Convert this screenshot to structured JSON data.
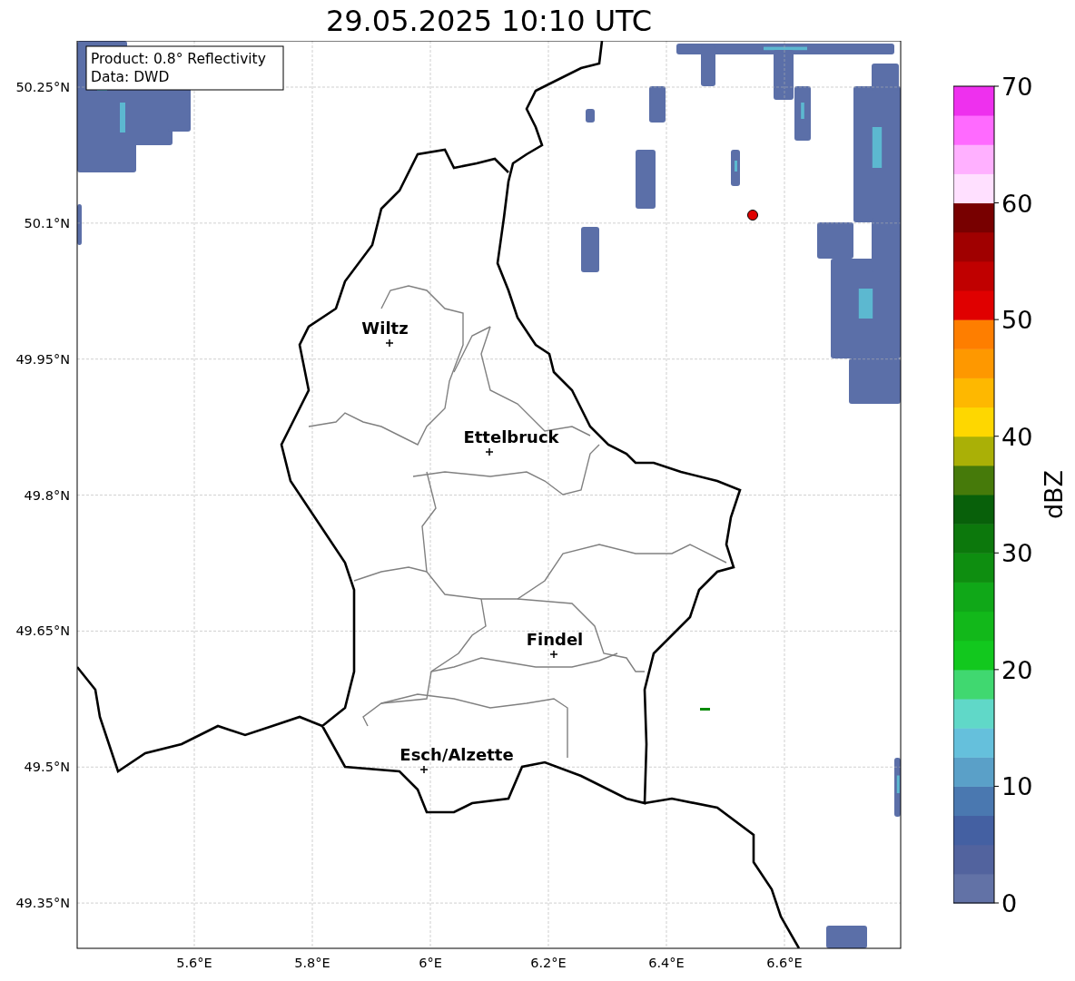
{
  "title": "29.05.2025 10:10 UTC",
  "map": {
    "info_box": [
      "Product: 0.8° Reflectivity",
      "Data: DWD"
    ],
    "lat_ticks": [
      "50.25°N",
      "50.1°N",
      "49.95°N",
      "49.8°N",
      "49.65°N",
      "49.5°N",
      "49.35°N"
    ],
    "lon_ticks": [
      "5.6°E",
      "5.8°E",
      "6°E",
      "6.2°E",
      "6.4°E",
      "6.6°E"
    ],
    "cities": [
      {
        "name": "Wiltz"
      },
      {
        "name": "Ettelbruck"
      },
      {
        "name": "Findel"
      },
      {
        "name": "Esch/Alzette"
      }
    ]
  },
  "colorbar": {
    "label": "dBZ",
    "ticks": [
      "70",
      "60",
      "50",
      "40",
      "30",
      "20",
      "10",
      "0"
    ]
  }
}
